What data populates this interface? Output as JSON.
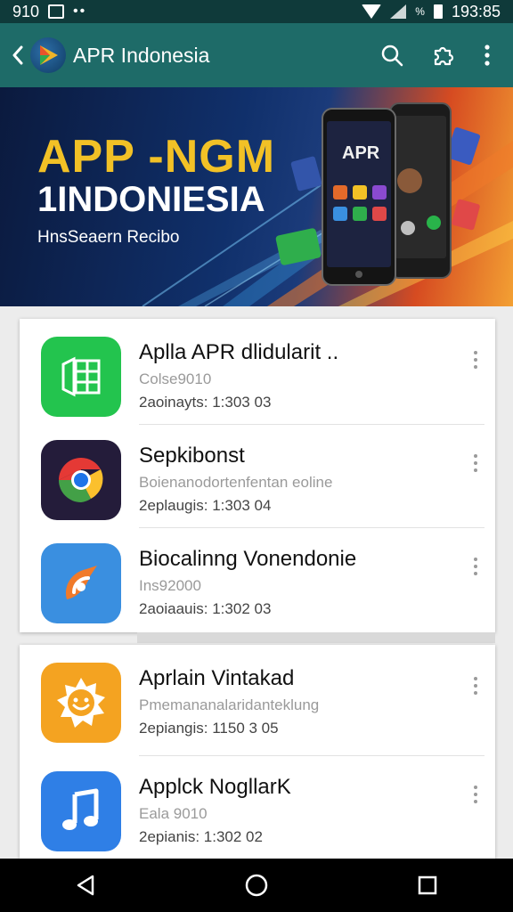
{
  "status_bar": {
    "time_left": "910",
    "time_right": "193:85",
    "small_text": "%"
  },
  "app_bar": {
    "title": "APR Indonesia"
  },
  "banner": {
    "title_line1": "APP -NGM",
    "title_line2": "1INDONIESIA",
    "subtitle": "HnsSeaern Recibo",
    "phone_label": "APR"
  },
  "apps": [
    {
      "name": "Aplla APR dlidularit ..",
      "sub": "Colse9010",
      "meta": "2aoinayts: 1:303 03",
      "icon": "table-app-icon",
      "color": "#23c44e"
    },
    {
      "name": "Sepkibonst",
      "sub": "Boienanodortenfentan eoline",
      "meta": "2eplaugis: 1:303 04",
      "icon": "chrome-icon",
      "color": "#241c3a"
    },
    {
      "name": "Biocalinng Vonendonie",
      "sub": "Ins92000",
      "meta": "2aoiaauis: 1:302 03",
      "icon": "brush-icon",
      "color": "#3a8fe0"
    },
    {
      "name": "Aprlain Vintakad",
      "sub": "Pmemananalaridanteklung",
      "meta": "2epiangis: 1150 3 05",
      "icon": "sun-icon",
      "color": "#f4a321"
    },
    {
      "name": "Applck NogllarK",
      "sub": "Eala 9010",
      "meta": "2epianis: 1:302 02",
      "icon": "music-icon",
      "color": "#2f7fe6"
    }
  ]
}
